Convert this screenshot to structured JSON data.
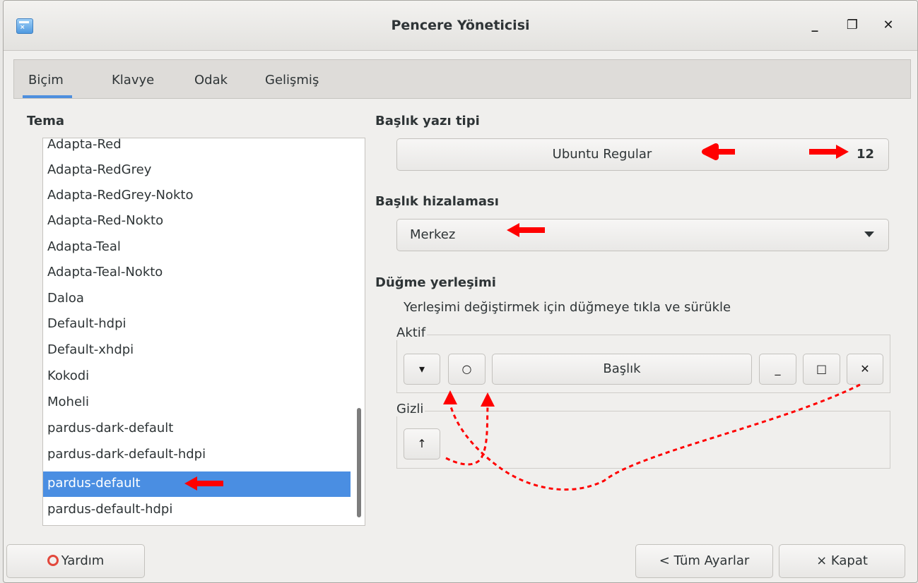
{
  "window": {
    "title": "Pencere Yöneticisi",
    "controls": {
      "minimize": "_",
      "maximize": "❐",
      "close": "✕"
    }
  },
  "tabs": [
    {
      "label": "Biçim",
      "active": true
    },
    {
      "label": "Klavye",
      "active": false
    },
    {
      "label": "Odak",
      "active": false
    },
    {
      "label": "Gelişmiş",
      "active": false
    }
  ],
  "theme": {
    "header": "Tema",
    "items": [
      "Adapta-Red",
      "Adapta-RedGrey",
      "Adapta-RedGrey-Nokto",
      "Adapta-Red-Nokto",
      "Adapta-Teal",
      "Adapta-Teal-Nokto",
      "Daloa",
      "Default-hdpi",
      "Default-xhdpi",
      "Kokodi",
      "Moheli",
      "pardus-dark-default",
      "pardus-dark-default-hdpi",
      "pardus-default",
      "pardus-default-hdpi"
    ],
    "selected": "pardus-default"
  },
  "title_font": {
    "header": "Başlık yazı tipi",
    "font_name": "Ubuntu Regular",
    "font_size": "12"
  },
  "title_alignment": {
    "header": "Başlık hizalaması",
    "value": "Merkez"
  },
  "button_layout": {
    "header": "Düğme yerleşimi",
    "description": "Yerleşimi değiştirmek için düğmeye tıkla ve sürükle",
    "active_label": "Aktif",
    "hidden_label": "Gizli",
    "active_buttons": {
      "menu": "▾",
      "stick": "○",
      "title": "Başlık",
      "minimize": "_",
      "maximize": "□",
      "close": "✕"
    },
    "hidden_buttons": {
      "shade": "↑"
    }
  },
  "footer": {
    "help_label": "Yardım",
    "all_settings_label": "< Tüm Ayarlar",
    "close_label": "× Kapat"
  },
  "colors": {
    "selection": "#4a8ee2",
    "tab_indicator": "#4d8fde",
    "annotation": "#ff0000"
  }
}
